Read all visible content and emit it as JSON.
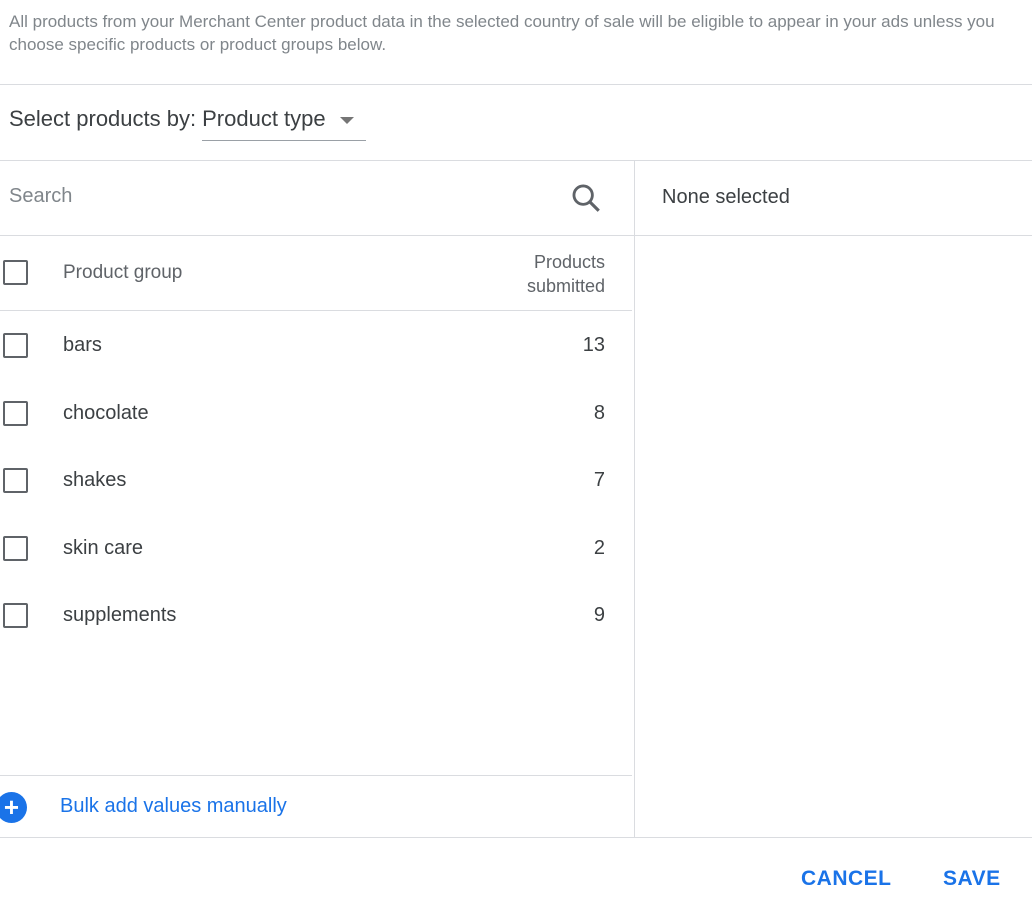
{
  "intro": "All products from your Merchant Center product data in the selected country of sale will be eligible to appear in your ads unless you choose specific products or product groups below.",
  "select": {
    "label": "Select products by:",
    "value": "Product type"
  },
  "search": {
    "placeholder": "Search",
    "icon": "search-icon"
  },
  "table": {
    "headers": {
      "group": "Product group",
      "count_line1": "Products",
      "count_line2": "submitted"
    },
    "rows": [
      {
        "name": "bars",
        "count": "13"
      },
      {
        "name": "chocolate",
        "count": "8"
      },
      {
        "name": "shakes",
        "count": "7"
      },
      {
        "name": "skin care",
        "count": "2"
      },
      {
        "name": "supplements",
        "count": "9"
      }
    ]
  },
  "bulk_add": "Bulk add values manually",
  "selected": "None selected",
  "buttons": {
    "cancel": "CANCEL",
    "save": "SAVE"
  },
  "colors": {
    "accent": "#1a73e8"
  }
}
